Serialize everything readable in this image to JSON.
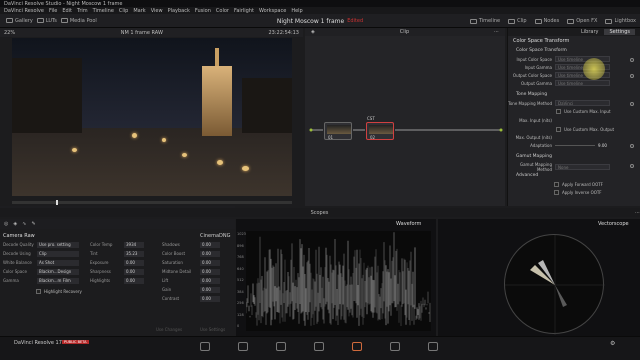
{
  "window": {
    "title": "DaVinci Resolve Studio - Night Moscow 1 frame"
  },
  "menu": [
    "DaVinci Resolve",
    "File",
    "Edit",
    "Trim",
    "Timeline",
    "Clip",
    "Mark",
    "View",
    "Playback",
    "Fusion",
    "Color",
    "Fairlight",
    "Workspace",
    "Help"
  ],
  "toolbar": {
    "left": [
      "Gallery",
      "LUTs",
      "Media Pool"
    ],
    "project": "Night Moscow 1 frame",
    "edited": "Edited",
    "right": [
      "Timeline",
      "Clip",
      "Nodes",
      "Open FX",
      "Lightbox"
    ]
  },
  "viewer": {
    "zoom": "22%",
    "clip": "NM 1 frame RAW",
    "timecode": "23:22:54:13"
  },
  "nodes": {
    "mode": "Clip",
    "labels": [
      "01",
      "02"
    ],
    "node2_title": "CST"
  },
  "inspector": {
    "tabs": [
      "Library",
      "Settings"
    ],
    "fx_title": "Color Space Transform",
    "sections": {
      "cst": "Color Space Transform",
      "tone": "Tone Mapping",
      "gamut": "Gamut Mapping",
      "adv": "Advanced"
    },
    "params": [
      {
        "label": "Input Color Space",
        "value": "Use timeline"
      },
      {
        "label": "Input Gamma",
        "value": "Use timeline"
      },
      {
        "label": "Output Color Space",
        "value": "Use timeline"
      },
      {
        "label": "Output Gamma",
        "value": "Use timeline"
      }
    ],
    "tone_method_label": "Tone Mapping Method",
    "tone_method": "DaVinci",
    "custom_max_input": "Use Custom Max. Input",
    "max_input_label": "Max. Input (nits)",
    "custom_max_output": "Use Custom Max. Output",
    "max_output_label": "Max. Output (nits)",
    "adaptation_label": "Adaptation",
    "adaptation_value": "9.00",
    "gamut_method_label": "Gamut Mapping Method",
    "gamut_method": "None",
    "apply_fwd": "Apply Forward OOTF",
    "apply_inv": "Apply Inverse OOTF"
  },
  "scopes": {
    "title": "Scopes",
    "waveform": "Waveform",
    "vectorscope": "Vectorscope",
    "wf_ticks": [
      "1023",
      "896",
      "768",
      "640",
      "512",
      "384",
      "256",
      "128",
      "0"
    ]
  },
  "camera_raw": {
    "title": "Camera Raw",
    "format": "CinemaDNG",
    "left": [
      {
        "label": "Decode Quality",
        "value": "Use pro. setting"
      },
      {
        "label": "Decode Using",
        "value": "Clip"
      },
      {
        "label": "White Balance",
        "value": "As Shot"
      },
      {
        "label": "Color Space",
        "value": "Blackm...Design"
      },
      {
        "label": "Gamma",
        "value": "Blackm...m Film"
      }
    ],
    "mid": [
      {
        "label": "Color Temp",
        "value": "3934"
      },
      {
        "label": "Tint",
        "value": "35.23"
      },
      {
        "label": "Exposure",
        "value": "0.00"
      },
      {
        "label": "Sharpness",
        "value": "0.00"
      },
      {
        "label": "Highlights",
        "value": "0.00"
      }
    ],
    "right": [
      {
        "label": "Shadows",
        "value": "0.00"
      },
      {
        "label": "Color Boost",
        "value": "0.00"
      },
      {
        "label": "Saturation",
        "value": "0.00"
      },
      {
        "label": "Midtone Detail",
        "value": "0.00"
      },
      {
        "label": "Lift",
        "value": "0.00"
      },
      {
        "label": "Gain",
        "value": "0.00"
      },
      {
        "label": "Contrast",
        "value": "0.00"
      }
    ],
    "highlight_recovery": "Highlight Recovery",
    "use_changes": "Use Changes",
    "use_settings": "Use Settings"
  },
  "footer": {
    "app": "DaVinci Resolve 17",
    "badge": "PUBLIC BETA"
  },
  "colors": {
    "accent": "#d06a3c",
    "badge": "#b52a2a"
  }
}
